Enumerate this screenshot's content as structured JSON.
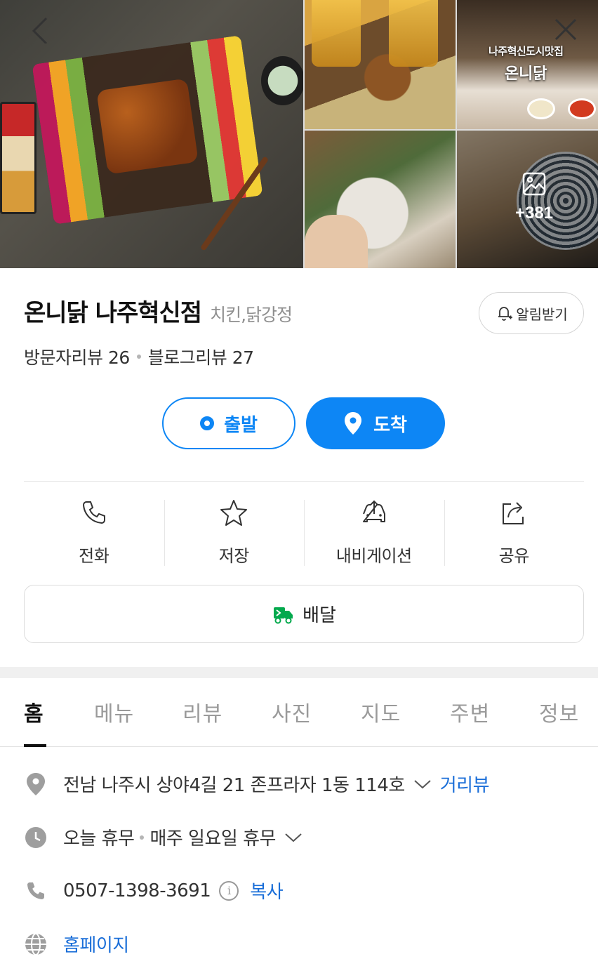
{
  "photos": {
    "sign_line1": "나주혁신도시맛집",
    "sign_line2": "온니닭",
    "more_count": "+381"
  },
  "place": {
    "name": "온니닭 나주혁신점",
    "category": "치킨,닭강정",
    "notify_label": "알림받기",
    "visitor_reviews": "방문자리뷰 26",
    "blog_reviews": "블로그리뷰 27"
  },
  "route": {
    "start_label": "출발",
    "arrive_label": "도착",
    "accent": "#0d86f5"
  },
  "actions": [
    {
      "label": "전화",
      "icon": "phone-icon"
    },
    {
      "label": "저장",
      "icon": "star-icon"
    },
    {
      "label": "내비게이션",
      "icon": "car-navigation-icon"
    },
    {
      "label": "공유",
      "icon": "share-icon"
    }
  ],
  "delivery": {
    "label": "배달",
    "icon": "delivery-truck-icon",
    "icon_color": "#03a94d"
  },
  "tabs": [
    {
      "label": "홈",
      "active": true
    },
    {
      "label": "메뉴"
    },
    {
      "label": "리뷰"
    },
    {
      "label": "사진"
    },
    {
      "label": "지도"
    },
    {
      "label": "주변"
    },
    {
      "label": "정보"
    }
  ],
  "info": {
    "address": "전남 나주시 상야4길 21 존프라자 1동 114호",
    "street_view": "거리뷰",
    "hours_status": "오늘 휴무",
    "hours_detail": "매주 일요일 휴무",
    "phone": "0507-1398-3691",
    "copy_label": "복사",
    "homepage": "홈페이지",
    "link_color": "#1a6ed8"
  }
}
